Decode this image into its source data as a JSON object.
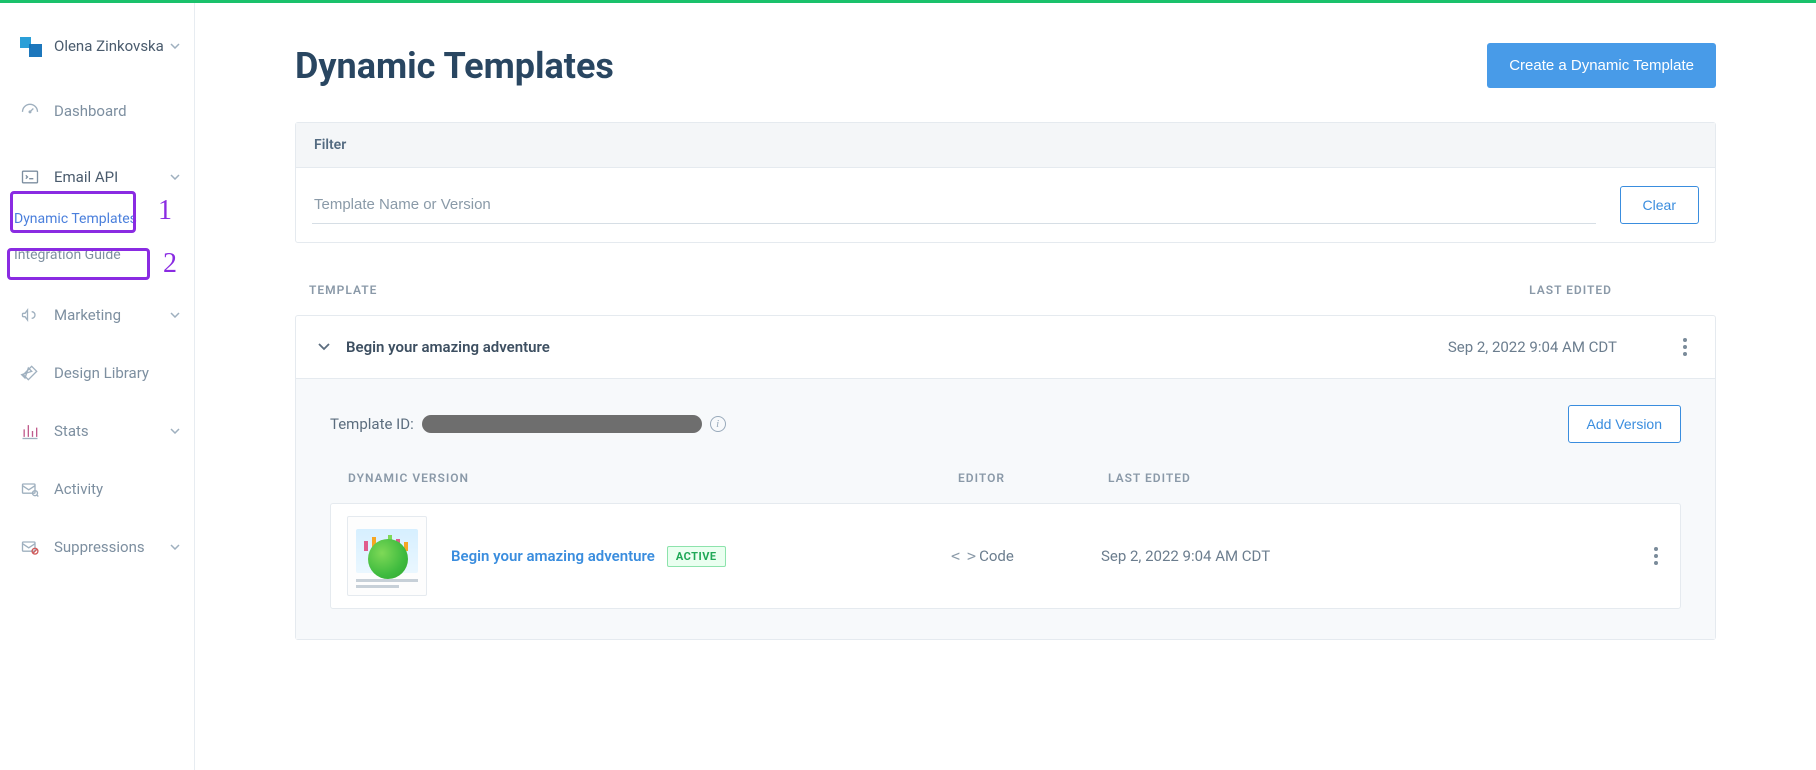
{
  "user": {
    "name": "Olena Zinkovska"
  },
  "annotations": {
    "one": "1",
    "two": "2"
  },
  "sidebar": {
    "dashboard": "Dashboard",
    "emailapi": "Email API",
    "dynamic_templates": "Dynamic Templates",
    "integration_guide": "Integration Guide",
    "marketing": "Marketing",
    "design_library": "Design Library",
    "stats": "Stats",
    "activity": "Activity",
    "suppressions": "Suppressions"
  },
  "page": {
    "title": "Dynamic Templates",
    "create_btn": "Create a Dynamic Template"
  },
  "filter": {
    "header": "Filter",
    "placeholder": "Template Name or Version",
    "clear": "Clear"
  },
  "table": {
    "col_template": "TEMPLATE",
    "col_last_edited": "LAST EDITED"
  },
  "template": {
    "name": "Begin your amazing adventure",
    "last_edited": "Sep 2, 2022 9:04 AM CDT",
    "template_id_label": "Template ID:",
    "add_version": "Add Version"
  },
  "versions": {
    "col_dv": "DYNAMIC VERSION",
    "col_editor": "EDITOR",
    "col_last_edited": "LAST EDITED",
    "row": {
      "name": "Begin your amazing adventure",
      "badge": "ACTIVE",
      "editor": "Code",
      "last_edited": "Sep 2, 2022 9:04 AM CDT"
    }
  }
}
